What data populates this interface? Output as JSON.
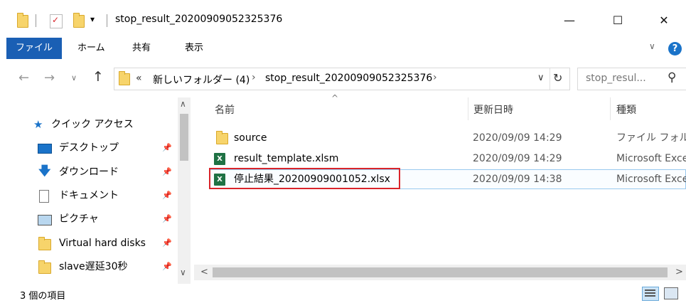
{
  "window": {
    "title": "stop_result_20200909052325376",
    "minimize": "—",
    "maximize": "☐",
    "close": "✕",
    "qa_dropdown": "▾"
  },
  "ribbon": {
    "tabs": [
      "ファイル",
      "ホーム",
      "共有",
      "表示"
    ],
    "expand": "∨",
    "help": "?"
  },
  "address": {
    "back": "←",
    "forward": "→",
    "history": "∨",
    "up": "↑",
    "overflow": "«",
    "crumbs": [
      "新しいフォルダー (4)",
      "stop_result_20200909052325376"
    ],
    "sep": "›",
    "dropdown": "∨",
    "refresh": "↻",
    "search_placeholder": "stop_resul...",
    "search_icon_glyph": "⚲"
  },
  "nav": {
    "items": [
      {
        "label": "クイック アクセス",
        "icon": "star-icon"
      },
      {
        "label": "デスクトップ",
        "icon": "desktop-icon"
      },
      {
        "label": "ダウンロード",
        "icon": "download-icon"
      },
      {
        "label": "ドキュメント",
        "icon": "document-icon"
      },
      {
        "label": "ピクチャ",
        "icon": "picture-icon"
      },
      {
        "label": "Virtual hard disks",
        "icon": "folder-icon"
      },
      {
        "label": "slave遅延30秒",
        "icon": "folder-icon"
      }
    ],
    "pin": "📌",
    "scroll_up": "∧",
    "scroll_down": "∨"
  },
  "columns": {
    "name": "名前",
    "modified": "更新日時",
    "type": "種類",
    "sort_indicator": "^"
  },
  "files": [
    {
      "name": "source",
      "modified": "2020/09/09 14:29",
      "type": "ファイル フォルダー",
      "icon": "folder-icon"
    },
    {
      "name": "result_template.xlsm",
      "modified": "2020/09/09 14:29",
      "type": "Microsoft Excel",
      "icon": "excel-icon"
    },
    {
      "name": "停止結果_20200909001052.xlsx",
      "modified": "2020/09/09 14:38",
      "type": "Microsoft Excel",
      "icon": "excel-icon"
    }
  ],
  "hscroll": {
    "left": "<",
    "right": ">"
  },
  "status": {
    "count": "3 個の項目"
  },
  "colors": {
    "file_tab": "#1a5fb4",
    "highlight": "#d9252b",
    "excel": "#1f7244",
    "folder": "#f7d46b"
  }
}
